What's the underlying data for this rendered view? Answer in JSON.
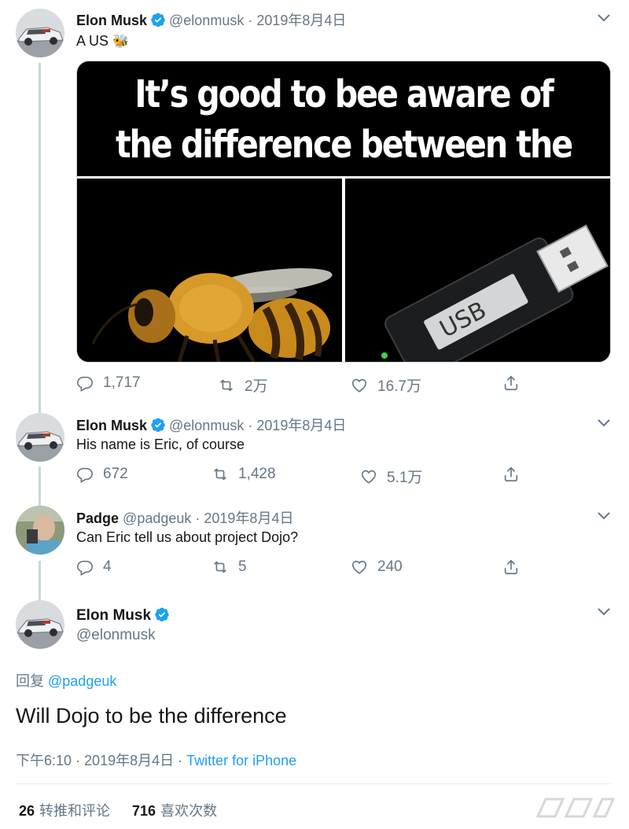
{
  "tweets": [
    {
      "name": "Elon Musk",
      "handle": "@elonmusk",
      "sep": " · ",
      "date": "2019年8月4日",
      "text": "A US",
      "emoji": "🐝",
      "media_title": "It’s good to bee aware of the difference between the two...",
      "media_usb_label": "USB",
      "replies": "1,717",
      "retweets": "2万",
      "likes": "16.7万"
    },
    {
      "name": "Elon Musk",
      "handle": "@elonmusk",
      "sep": " · ",
      "date": "2019年8月4日",
      "text": "His name is Eric, of course",
      "replies": "672",
      "retweets": "1,428",
      "likes": "5.1万"
    },
    {
      "name": "Padge",
      "handle": "@padgeuk",
      "sep": " · ",
      "date": "2019年8月4日",
      "text": "Can Eric tell us about project Dojo?",
      "replies": "4",
      "retweets": "5",
      "likes": "240"
    }
  ],
  "main_tweet": {
    "name": "Elon Musk",
    "handle": "@elonmusk",
    "reply_prefix": "回复 ",
    "reply_to": "@padgeuk",
    "text": "Will Dojo to be the difference",
    "time": "下午6:10",
    "sep": " · ",
    "date": "2019年8月4日",
    "sep2": " · ",
    "source": "Twitter for iPhone",
    "retweet_count": "26",
    "retweet_label": "转推和评论",
    "like_count": "716",
    "like_label": "喜欢次数"
  },
  "colors": {
    "accent": "#1da1f2",
    "muted": "#657786",
    "text": "#14171a",
    "line": "#ccd6dd"
  },
  "icons": [
    "verified-badge-icon",
    "chevron-down-icon",
    "reply-icon",
    "retweet-icon",
    "like-icon",
    "share-icon"
  ]
}
